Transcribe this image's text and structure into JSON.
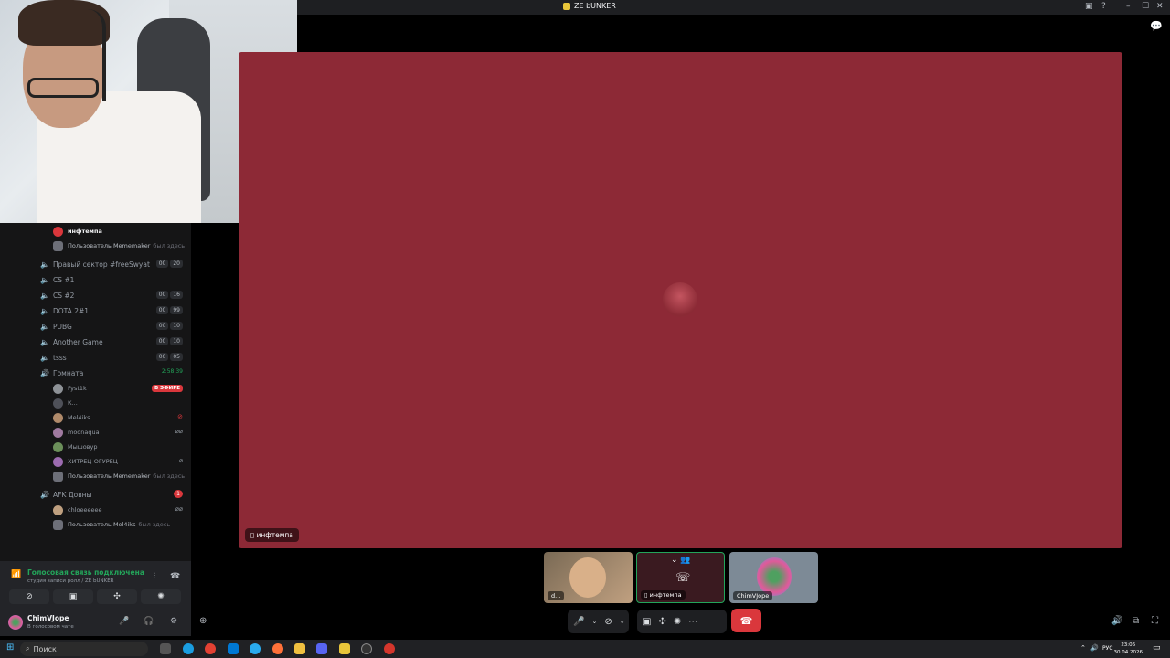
{
  "window": {
    "title": "ZE bUNKER"
  },
  "sidebar": {
    "stream_user": "инфтемпа",
    "visitor_note": {
      "prefix": "Пользователь",
      "name": "Mememaker",
      "suffix": "был здесь"
    },
    "channels": [
      {
        "name": "Правый сектор #freeSwyat",
        "counts": [
          "00",
          "20"
        ]
      },
      {
        "name": "CS #1",
        "counts": []
      },
      {
        "name": "CS #2",
        "counts": [
          "00",
          "16"
        ]
      },
      {
        "name": "DOTA 2#1",
        "counts": [
          "00",
          "99"
        ]
      },
      {
        "name": "PUBG",
        "counts": [
          "00",
          "10"
        ]
      },
      {
        "name": "Another Game",
        "counts": [
          "00",
          "10"
        ]
      },
      {
        "name": "tsss",
        "counts": [
          "00",
          "05"
        ]
      }
    ],
    "active_channel": {
      "name": "Гомната",
      "timer": "2:58:39"
    },
    "members": [
      {
        "name": "Fyst1k",
        "badge": "В ЭФИРЕ"
      },
      {
        "name": "К...",
        "badge": ""
      },
      {
        "name": "Mel4iks",
        "badge": ""
      },
      {
        "name": "moonaqua",
        "badge": ""
      },
      {
        "name": "Мышовур",
        "badge": ""
      },
      {
        "name": "ХИТРЕЦ-ОГУРЕЦ",
        "badge": ""
      }
    ],
    "members_note": {
      "prefix": "Пользователь",
      "name": "Mememaker",
      "suffix": "был здесь"
    },
    "afk_channel": {
      "name": "AFK Довны",
      "count": "1"
    },
    "afk_members": [
      {
        "name": "chloeeeeee"
      }
    ],
    "afk_note": {
      "prefix": "Пользователь",
      "name": "Mel4iks",
      "suffix": "был здесь"
    }
  },
  "voice_panel": {
    "status": "Голосовая связь подключена",
    "subtitle": "студия записи ролл / ZE bUNKER"
  },
  "user": {
    "name": "ChimVJope",
    "status": "В голосовом чате"
  },
  "stage": {
    "tag": "инфтемпа"
  },
  "tiles": [
    {
      "label": "d..."
    },
    {
      "label": "инфтемпа"
    },
    {
      "label": "ChimVJope"
    }
  ],
  "taskbar": {
    "search_placeholder": "Поиск",
    "lang": "РУС",
    "time": "23:06",
    "date": "30.04.2026"
  },
  "colors": {
    "stage_bg": "#8d2936",
    "end_call": "#da373c",
    "connected": "#23a55a"
  }
}
